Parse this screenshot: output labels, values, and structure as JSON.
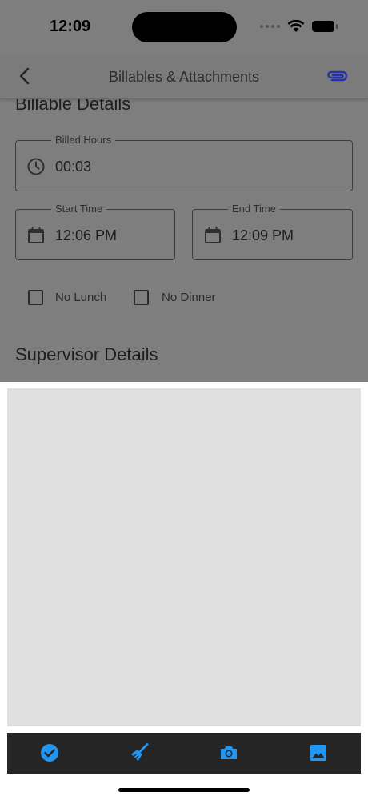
{
  "status_bar": {
    "time": "12:09"
  },
  "header": {
    "title": "Billables & Attachments"
  },
  "billable": {
    "section_title": "Billable Details",
    "billed_hours": {
      "label": "Billed Hours",
      "value": "00:03"
    },
    "start_time": {
      "label": "Start Time",
      "value": "12:06 PM"
    },
    "end_time": {
      "label": "End Time",
      "value": "12:09 PM"
    },
    "no_lunch": {
      "label": "No Lunch",
      "checked": false
    },
    "no_dinner": {
      "label": "No Dinner",
      "checked": false
    }
  },
  "supervisor": {
    "section_title": "Supervisor Details"
  },
  "toolbar": {
    "items": [
      {
        "icon": "check-circle-icon"
      },
      {
        "icon": "broom-icon"
      },
      {
        "icon": "camera-icon"
      },
      {
        "icon": "image-icon"
      }
    ],
    "accent_color": "#2196f3"
  },
  "colors": {
    "overlay_page": "#7e7e7e",
    "canvas": "#e0e0e0",
    "toolbar_bg": "#252525",
    "attach_icon": "#2732a8"
  }
}
